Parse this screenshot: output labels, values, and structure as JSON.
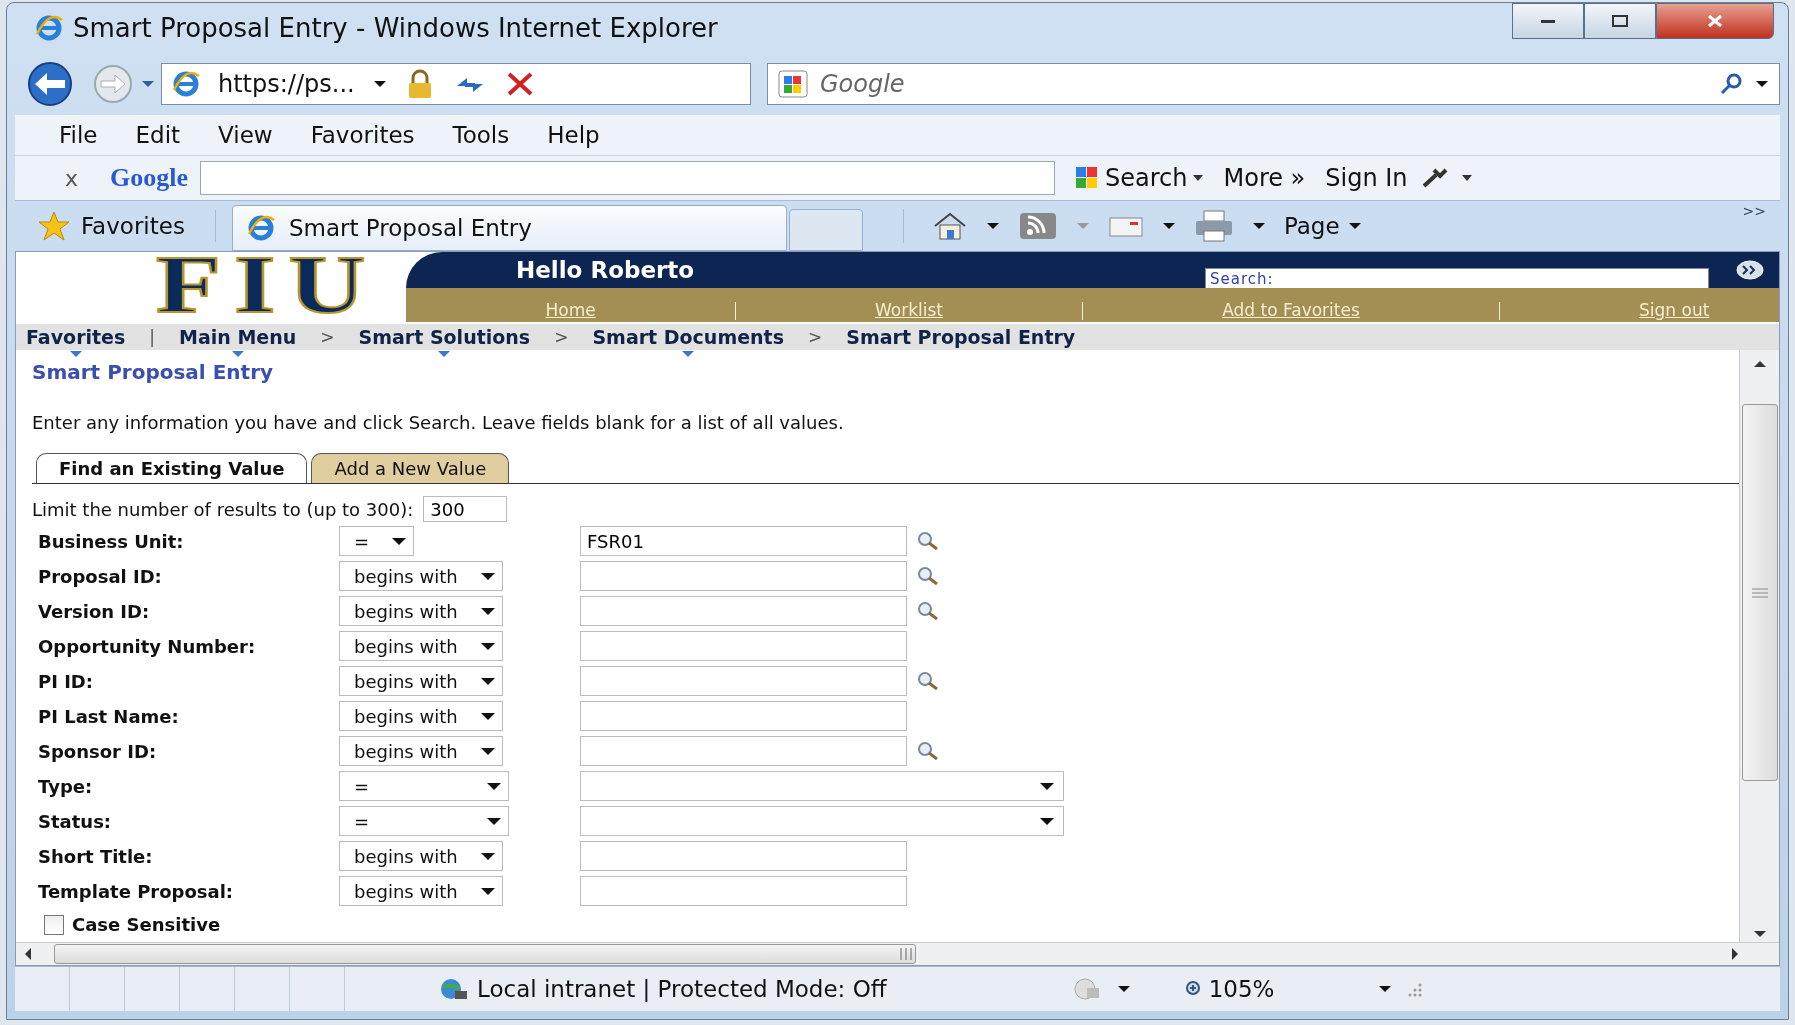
{
  "window": {
    "title": "Smart Proposal Entry - Windows Internet Explorer"
  },
  "address_bar": {
    "url": "https://ps...",
    "search_placeholder": "Google"
  },
  "menu": [
    "File",
    "Edit",
    "View",
    "Favorites",
    "Tools",
    "Help"
  ],
  "google_toolbar": {
    "close": "x",
    "logo": "Google",
    "search": "Search",
    "more": "More »",
    "sign_in": "Sign In"
  },
  "favorites_bar": {
    "favorites": "Favorites",
    "tabs": [
      {
        "label": "Smart Proposal Entry",
        "selected": true
      }
    ],
    "page": "Page",
    "overflow": ">>"
  },
  "header": {
    "logo": "FIU",
    "greeting": "Hello Roberto",
    "search_placeholder": "Search:",
    "links": [
      "Home",
      "Worklist",
      "Add to Favorites",
      "Sign out"
    ]
  },
  "breadcrumb": [
    {
      "kind": "link",
      "label": "Favorites",
      "dropdown": true
    },
    {
      "kind": "separator",
      "label": "|"
    },
    {
      "kind": "link",
      "label": "Main Menu",
      "dropdown": true
    },
    {
      "kind": "separator",
      "label": ">"
    },
    {
      "kind": "link",
      "label": "Smart Solutions",
      "dropdown": true
    },
    {
      "kind": "separator",
      "label": ">"
    },
    {
      "kind": "link",
      "label": "Smart Documents",
      "dropdown": true
    },
    {
      "kind": "separator",
      "label": ">"
    },
    {
      "kind": "link",
      "label": "Smart Proposal Entry",
      "dropdown": false
    }
  ],
  "page": {
    "title": "Smart Proposal Entry",
    "instructions": "Enter any information you have and click Search. Leave fields blank for a list of all values.",
    "tabs": [
      {
        "label": "Find an Existing Value",
        "selected": true
      },
      {
        "label": "Add a New Value",
        "selected": false
      }
    ],
    "limit": {
      "label": "Limit the number of results to (up to 300):",
      "value": "300"
    },
    "fields": [
      {
        "label": "Business Unit:",
        "operator": "=",
        "kind": "text",
        "value": "FSR01",
        "lookup": true
      },
      {
        "label": "Proposal ID:",
        "operator": "begins with",
        "kind": "text",
        "lookup": true
      },
      {
        "label": "Version ID:",
        "operator": "begins with",
        "kind": "text",
        "lookup": true
      },
      {
        "label": "Opportunity Number:",
        "operator": "begins with",
        "kind": "text",
        "lookup": false
      },
      {
        "label": "PI ID:",
        "operator": "begins with",
        "kind": "text",
        "lookup": true
      },
      {
        "label": "PI Last Name:",
        "operator": "begins with",
        "kind": "text",
        "lookup": false
      },
      {
        "label": "Sponsor ID:",
        "operator": "begins with",
        "kind": "text",
        "lookup": true
      },
      {
        "label": "Type:",
        "operator": "=",
        "kind": "select",
        "lookup": false
      },
      {
        "label": "Status:",
        "operator": "=",
        "kind": "select",
        "lookup": false
      },
      {
        "label": "Short Title:",
        "operator": "begins with",
        "kind": "text",
        "lookup": false
      },
      {
        "label": "Template Proposal:",
        "operator": "begins with",
        "kind": "text",
        "lookup": false
      }
    ],
    "case_sensitive": {
      "label": "Case Sensitive",
      "checked": false
    }
  },
  "status_bar": {
    "zone": "Local intranet | Protected Mode: Off",
    "zoom": "105%"
  }
}
